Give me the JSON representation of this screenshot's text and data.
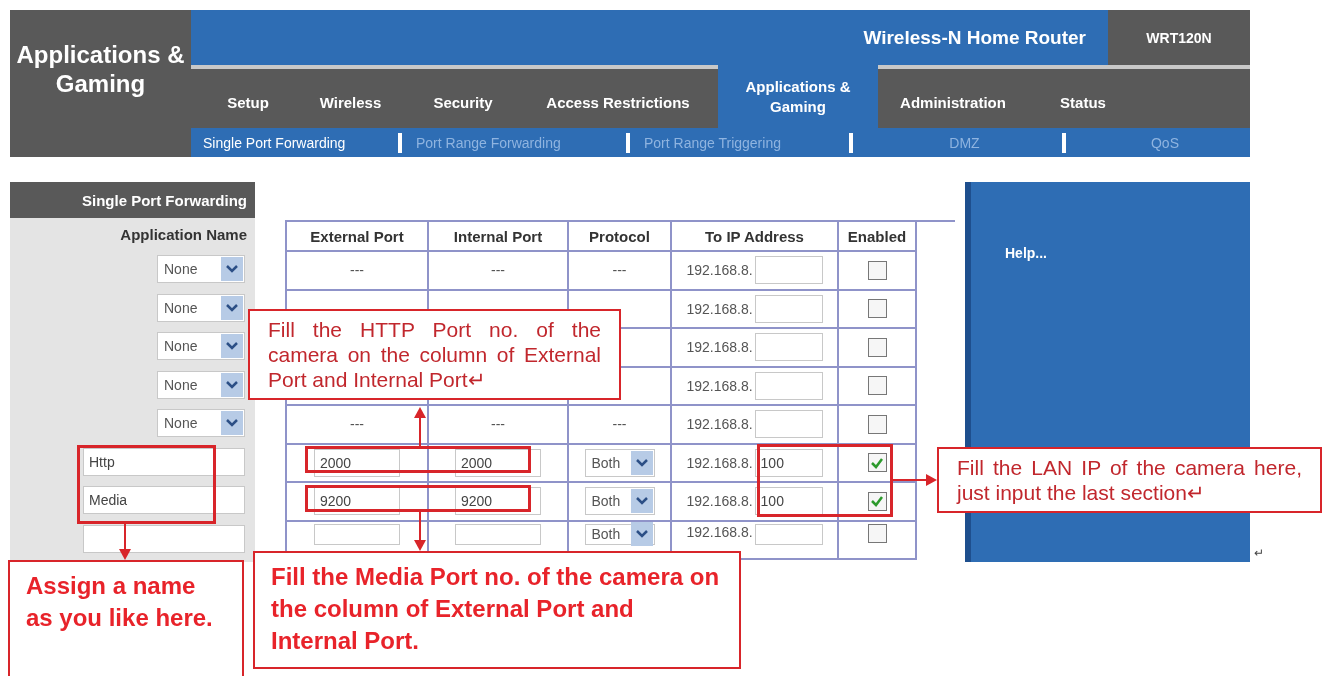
{
  "header": {
    "title": "Applications & Gaming",
    "product": "Wireless-N Home Router",
    "model": "WRT120N"
  },
  "tabs": [
    {
      "label": "Setup",
      "selected": false
    },
    {
      "label": "Wireless",
      "selected": false
    },
    {
      "label": "Security",
      "selected": false
    },
    {
      "label": "Access Restrictions",
      "selected": false
    },
    {
      "label": "Applications & Gaming",
      "selected": true
    },
    {
      "label": "Administration",
      "selected": false
    },
    {
      "label": "Status",
      "selected": false
    }
  ],
  "subtabs": [
    {
      "label": "Single Port Forwarding",
      "selected": true
    },
    {
      "label": "Port Range Forwarding",
      "selected": false
    },
    {
      "label": "Port Range Triggering",
      "selected": false
    },
    {
      "label": "DMZ",
      "selected": false
    },
    {
      "label": "QoS",
      "selected": false
    }
  ],
  "sidebar": {
    "title": "Single Port Forwarding",
    "column": "Application Name"
  },
  "table": {
    "columns": [
      "External Port",
      "Internal Port",
      "Protocol",
      "To IP Address",
      "Enabled"
    ],
    "rows": [
      {
        "kind": "preset",
        "app": "None",
        "external": "---",
        "internal": "---",
        "protocol": "---",
        "ip_prefix": "192.168.8.",
        "enabled": false
      },
      {
        "kind": "preset",
        "app": "None",
        "ip_prefix": "192.168.8.",
        "enabled": false
      },
      {
        "kind": "preset",
        "app": "None",
        "ip_prefix": "192.168.8.",
        "enabled": false
      },
      {
        "kind": "preset",
        "app": "None",
        "ip_prefix": "192.168.8.",
        "enabled": false
      },
      {
        "kind": "preset",
        "app": "None",
        "external": "---",
        "internal": "---",
        "protocol": "---",
        "ip_prefix": "192.168.8.",
        "enabled": false
      },
      {
        "kind": "custom",
        "app": "Http",
        "external": "2000",
        "internal": "2000",
        "protocol": "Both",
        "ip_prefix": "192.168.8.",
        "ip_suffix": "100",
        "enabled": true
      },
      {
        "kind": "custom",
        "app": "Media",
        "external": "9200",
        "internal": "9200",
        "protocol": "Both",
        "ip_prefix": "192.168.8.",
        "ip_suffix": "100",
        "enabled": true
      },
      {
        "kind": "custom",
        "protocol": "Both",
        "ip_prefix": "192.168.8.",
        "enabled": false
      }
    ]
  },
  "help": {
    "label": "Help..."
  },
  "annotations": [
    {
      "kind": "note",
      "text": "Fill the HTTP Port no. of the camera on the column of External Port and Internal Port↵"
    },
    {
      "kind": "note",
      "text": "Fill the LAN IP of the camera here, just input the last section↵"
    },
    {
      "kind": "bold",
      "text": "Assign a name as you like here."
    },
    {
      "kind": "bold",
      "text": "Fill the Media Port no. of the camera on the column of External Port and Internal Port."
    }
  ],
  "paragraph_mark": "↵"
}
